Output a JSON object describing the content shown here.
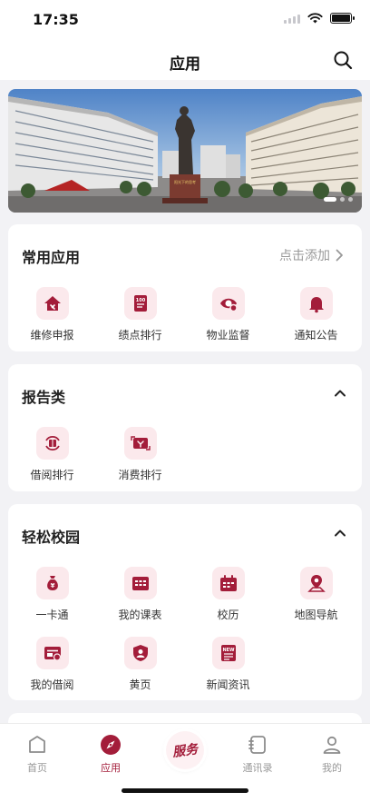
{
  "status": {
    "time": "17:35"
  },
  "nav": {
    "title": "应用"
  },
  "banner": {
    "plaque_text": "阳光下的思考"
  },
  "frequent": {
    "title": "常用应用",
    "action": "点击添加",
    "apps": [
      {
        "label": "维修申报",
        "icon": "repair-house-icon"
      },
      {
        "label": "绩点排行",
        "icon": "gpa-document-icon"
      },
      {
        "label": "物业监督",
        "icon": "supervision-eye-icon"
      },
      {
        "label": "通知公告",
        "icon": "notification-bell-icon"
      }
    ]
  },
  "reports": {
    "title": "报告类",
    "apps": [
      {
        "label": "借阅排行",
        "icon": "borrow-rank-icon"
      },
      {
        "label": "消费排行",
        "icon": "spending-rank-icon"
      }
    ]
  },
  "campus": {
    "title": "轻松校园",
    "apps": [
      {
        "label": "一卡通",
        "icon": "money-bag-icon"
      },
      {
        "label": "我的课表",
        "icon": "timetable-icon"
      },
      {
        "label": "校历",
        "icon": "calendar-icon"
      },
      {
        "label": "地图导航",
        "icon": "map-pin-icon"
      },
      {
        "label": "我的借阅",
        "icon": "my-borrow-icon"
      },
      {
        "label": "黄页",
        "icon": "yellow-pages-icon"
      },
      {
        "label": "新闻资讯",
        "icon": "news-icon"
      }
    ]
  },
  "tabbar": {
    "home": "首页",
    "apps": "应用",
    "center": "服务",
    "contacts": "通讯录",
    "mine": "我的"
  },
  "colors": {
    "accent": "#a31d3a",
    "icon_bg": "#fbe9ec",
    "page_bg": "#f2f2f5"
  }
}
